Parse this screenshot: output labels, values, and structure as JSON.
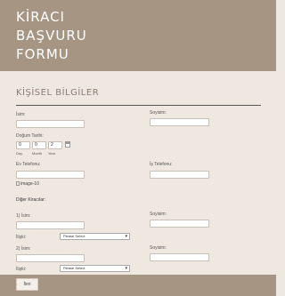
{
  "header": {
    "title_lines": [
      "KİRACI",
      "BAŞVURU",
      "FORMU"
    ]
  },
  "section": {
    "title": "KİŞİSEL BİLGİLER"
  },
  "form": {
    "first_name_label": "İsim:",
    "last_name_label": "Soyisim:",
    "dob_label": "Doğum Tarihi:",
    "dob_day_value": "0",
    "dob_month_value": "0",
    "dob_year_value": "2",
    "dob_day_sub": "Day",
    "dob_month_sub": "Month",
    "dob_year_sub": "Year",
    "home_phone_label": "Ev Telefonu:",
    "work_phone_label": "İş Telefonu:",
    "image_alt": "image-10",
    "other_tenants_label": "Diğer Kiracılar:",
    "tenant1_name_label": "1) İsim:",
    "tenant1_surname_label": "Soyisim:",
    "tenant1_relation_label": "İlişki:",
    "tenant1_relation_value": "Please Select",
    "tenant2_name_label": "2) İsim:",
    "tenant2_surname_label": "Soyisim:",
    "tenant2_relation_label": "İlişki:",
    "tenant2_relation_value": "Please Select"
  },
  "footer": {
    "next_label": "İleri"
  },
  "colors": {
    "brand": "#a69583",
    "background": "#efe8e1"
  },
  "icons": {
    "calendar": "calendar-icon",
    "dropdown": "chevron-down-icon"
  }
}
